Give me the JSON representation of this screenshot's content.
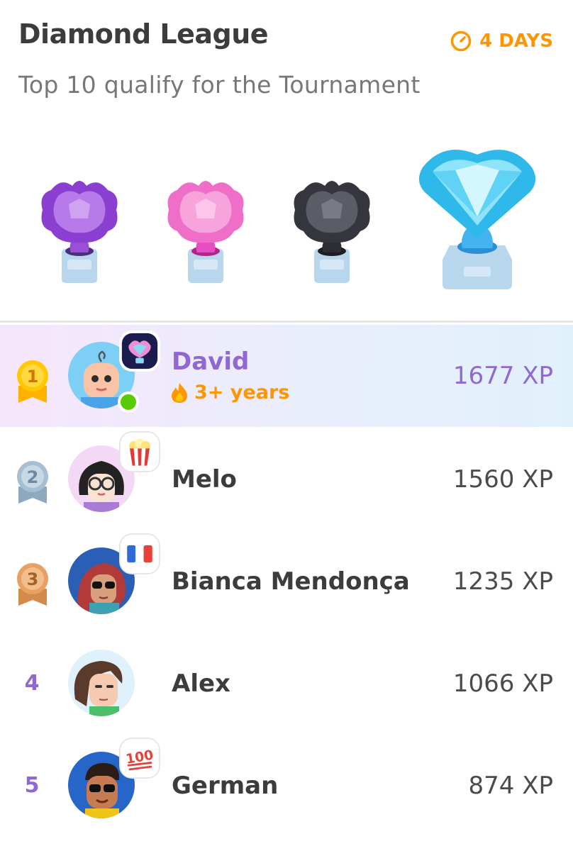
{
  "header": {
    "title": "Diamond League",
    "timer_label": "4 DAYS",
    "subtitle": "Top 10 qualify for the Tournament"
  },
  "trophies": [
    {
      "name": "amethyst-trophy",
      "color": "#a35ee0"
    },
    {
      "name": "pearl-trophy",
      "color": "#f28ad6"
    },
    {
      "name": "obsidian-trophy",
      "color": "#4b4b55"
    },
    {
      "name": "diamond-trophy",
      "color": "#5cd0f2"
    }
  ],
  "leaderboard": [
    {
      "rank": "1",
      "name": "David",
      "xp": "1677 XP",
      "streak": "3+ years",
      "badge": "league-badge-icon",
      "current_user": true,
      "online": true
    },
    {
      "rank": "2",
      "name": "Melo",
      "xp": "1560 XP",
      "badge": "popcorn-icon"
    },
    {
      "rank": "3",
      "name": "Bianca Mendonça",
      "xp": "1235 XP",
      "badge": "france-flag-icon"
    },
    {
      "rank": "4",
      "name": "Alex",
      "xp": "1066 XP"
    },
    {
      "rank": "5",
      "name": "German",
      "xp": "874 XP",
      "badge": "hundred-points-icon"
    }
  ],
  "colors": {
    "accent_purple": "#9068d2",
    "streak_orange": "#ff9600",
    "medal_gold": "#ffc800",
    "medal_silver": "#a7bfd2",
    "medal_bronze": "#e8a063"
  }
}
